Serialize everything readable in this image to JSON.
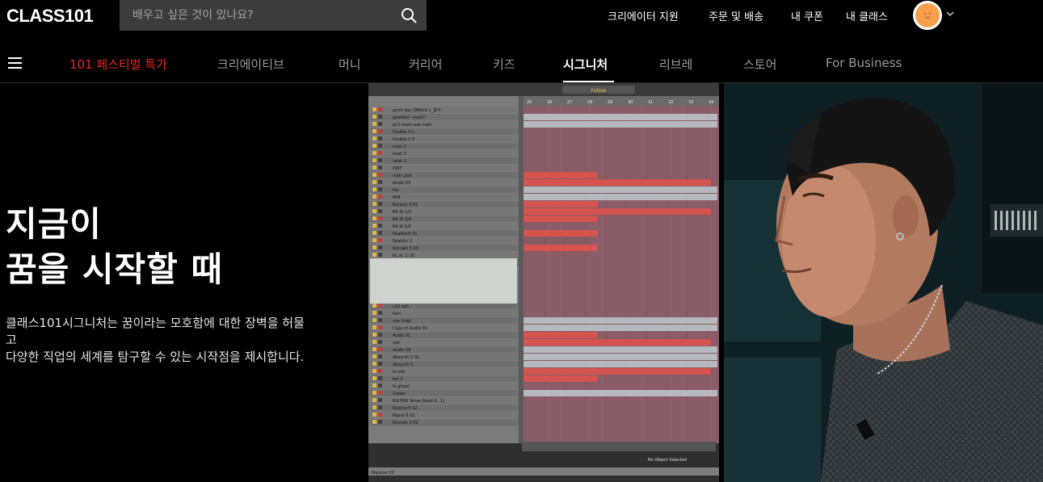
{
  "header": {
    "logo": "CLASS101",
    "search_placeholder": "배우고 싶은 것이 있나요?",
    "links": [
      "크리에이터 지원",
      "주문 및 배송",
      "내 쿠폰",
      "내 클래스"
    ],
    "avatar_color": "#f6a04c"
  },
  "nav": {
    "items": [
      "101 페스티벌 특가",
      "크리에이티브",
      "머니",
      "커리어",
      "키즈",
      "시그니처",
      "리브레",
      "스토어",
      "For Business"
    ],
    "active_index": 5,
    "promo_color": "#e32626"
  },
  "hero": {
    "title_line1": "지금이",
    "title_line2": "꿈을 시작할 때",
    "desc_line1": "클래스101시그니처는 꿈이라는 모호함에 대한 장벽을 허물",
    "desc_line2": "고",
    "desc_line3": "다양한 직업의 세계를 탐구할 수 있는 시작점을 제시합니다."
  },
  "daw": {
    "tracks": [
      "good day QWALA v_합수",
      "goodkid - main?",
      "ph1-hook-sub-main",
      "Double 2 L",
      "Double 2 R",
      "hook 2",
      "hook 3",
      "hook 1",
      "INST",
      "main pad",
      "Audio 03",
      "hel",
      "808",
      "Battery 4 01",
      "B4 St 1/2",
      "B4 St 3/4",
      "B4 St 5/6",
      "Reaktor5 01",
      "Reaktor 1",
      "Kontakt 5 03",
      "KL st. 1 (3)",
      "Massive 01",
      "",
      "",
      "",
      "",
      "",
      "x12 ooh",
      "tem",
      "vox chop",
      "Copy of Audio 03",
      "Audio 01",
      "ooh",
      "Audio 04",
      "Absynth 5 01",
      "Absynth 5",
      "fx ooh",
      "hel 3",
      "fx ghost",
      "Guitar",
      "Kid Milli Verse (beat d...1)",
      "Reaktor5 02",
      "Repro-5 01",
      "Kontakt 5 02"
    ],
    "ruler": [
      "25",
      "26",
      "27",
      "28",
      "29",
      "30",
      "31",
      "32",
      "33",
      "34"
    ],
    "transport_follow": "Follow",
    "status": "No Object Selected",
    "bottom_track": "Massive 01"
  }
}
